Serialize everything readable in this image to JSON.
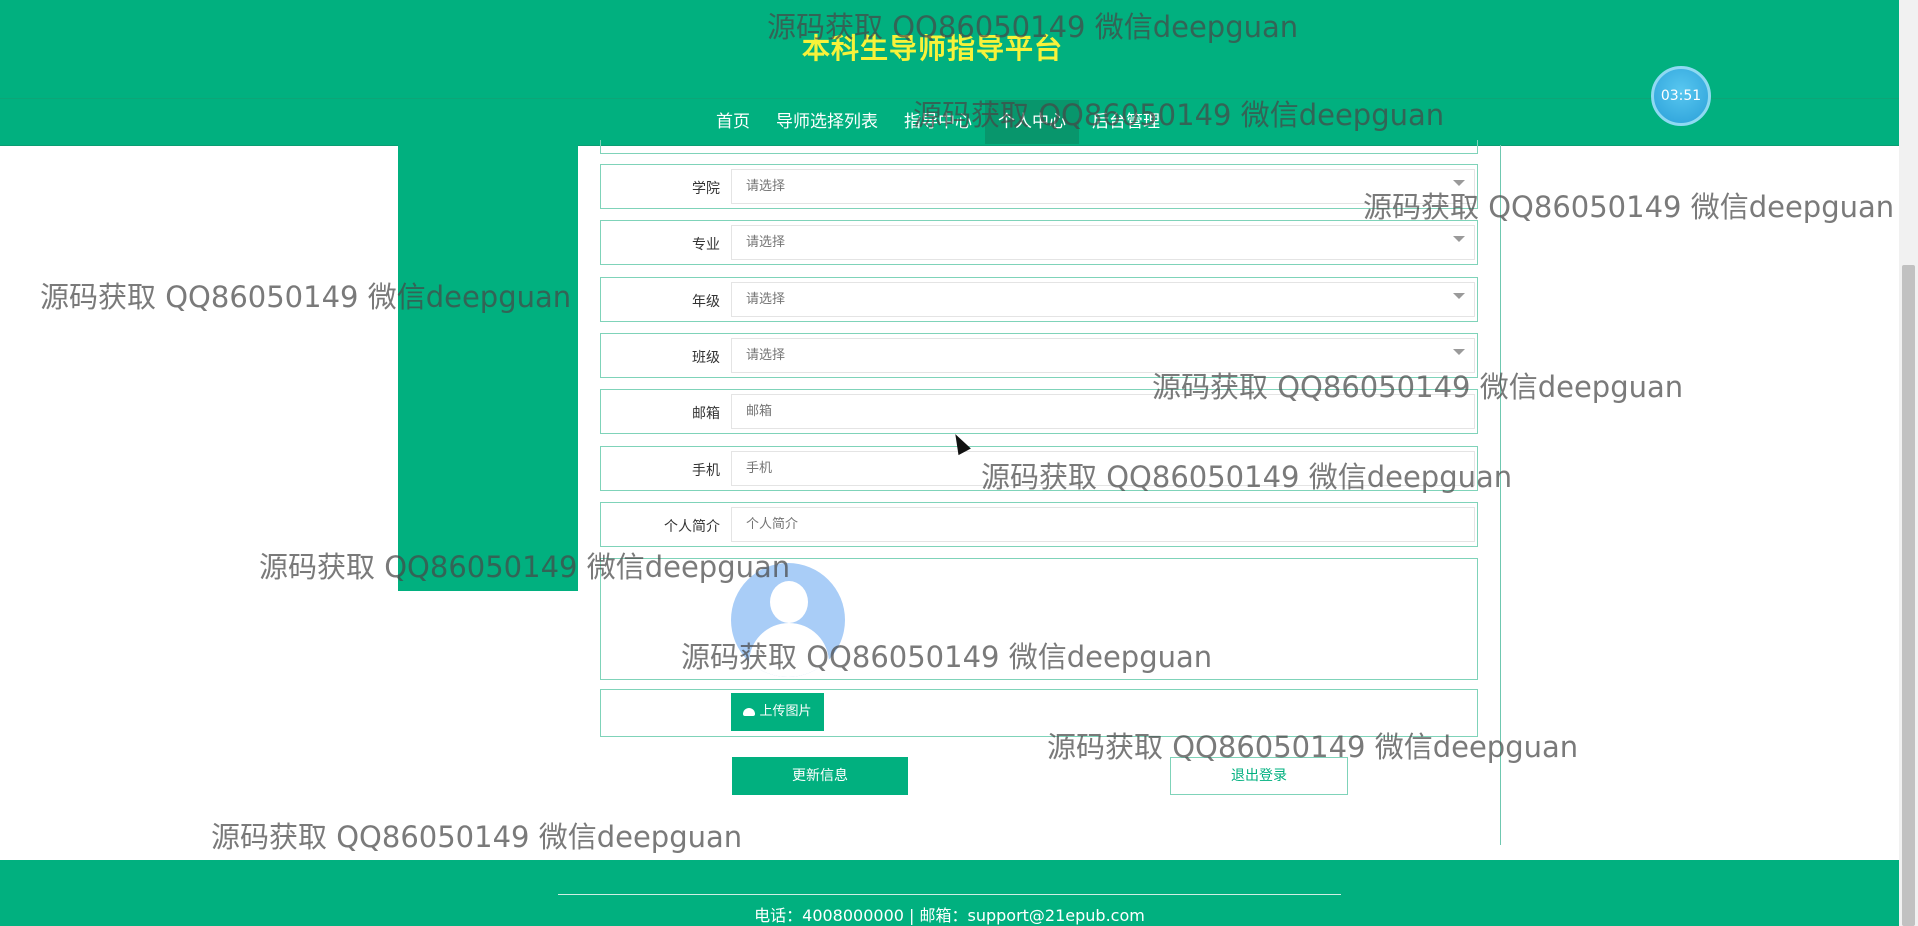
{
  "header": {
    "site_title": "本科生导师指导平台",
    "timer": "03:51",
    "nav": [
      "首页",
      "导师选择列表",
      "指导中心",
      "个人中心",
      "后台管理"
    ],
    "active_nav_index": 3
  },
  "form": {
    "fields": [
      {
        "label": "学院",
        "value": "请选择",
        "type": "select"
      },
      {
        "label": "专业",
        "value": "请选择",
        "type": "select"
      },
      {
        "label": "年级",
        "value": "请选择",
        "type": "select"
      },
      {
        "label": "班级",
        "value": "请选择",
        "type": "select"
      },
      {
        "label": "邮箱",
        "value": "邮箱",
        "type": "input"
      },
      {
        "label": "手机",
        "value": "手机",
        "type": "input"
      },
      {
        "label": "个人简介",
        "value": "个人简介",
        "type": "input"
      }
    ],
    "upload_label": "上传图片",
    "update_label": "更新信息",
    "logout_label": "退出登录"
  },
  "footer": {
    "contact": "电话：4008000000 | 邮箱：support@21epub.com"
  },
  "watermark": "源码获取 QQ86050149 微信deepguan",
  "colors": {
    "primary": "#01b07f",
    "title": "#f7f23a"
  }
}
